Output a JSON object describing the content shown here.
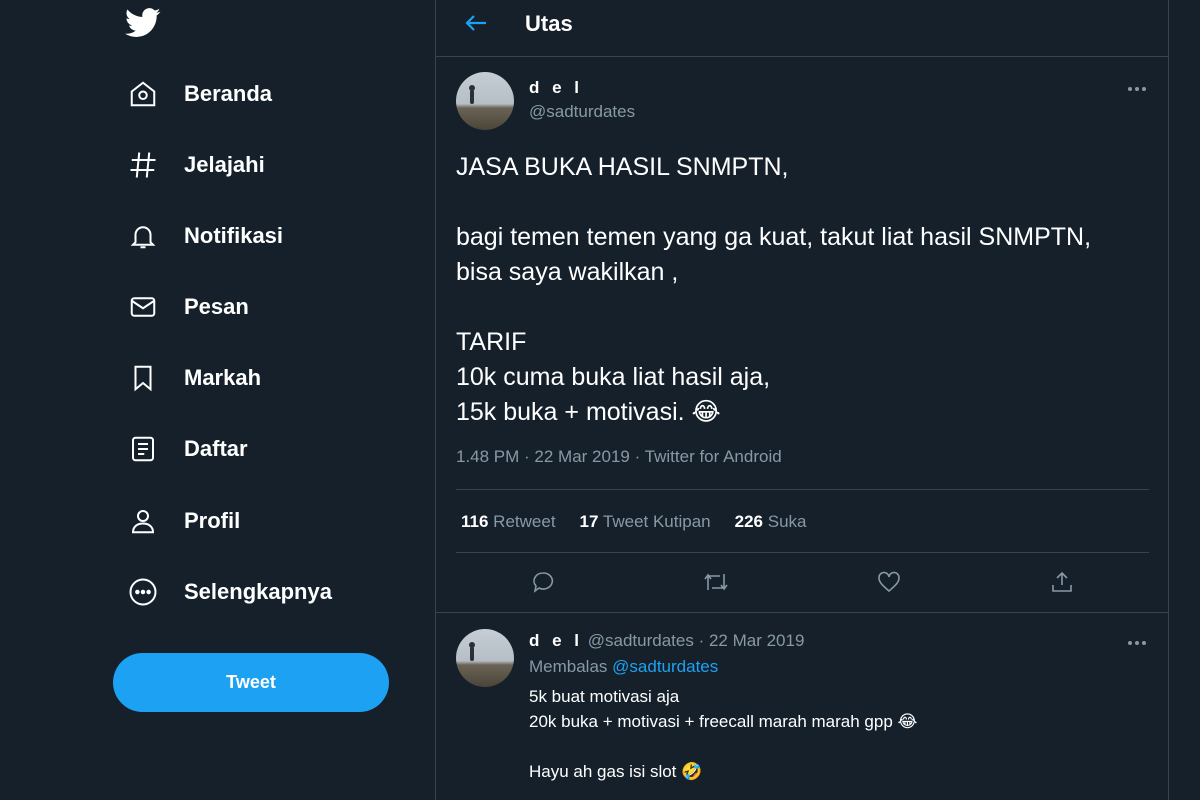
{
  "sidebar": {
    "logo_icon": "twitter-bird-icon",
    "items": [
      {
        "label": "Beranda",
        "icon": "home-icon"
      },
      {
        "label": "Jelajahi",
        "icon": "hashtag-icon"
      },
      {
        "label": "Notifikasi",
        "icon": "bell-icon"
      },
      {
        "label": "Pesan",
        "icon": "mail-icon"
      },
      {
        "label": "Markah",
        "icon": "bookmark-icon"
      },
      {
        "label": "Daftar",
        "icon": "list-icon"
      },
      {
        "label": "Profil",
        "icon": "profile-icon"
      },
      {
        "label": "Selengkapnya",
        "icon": "more-circle-icon"
      }
    ],
    "tweet_button": "Tweet"
  },
  "header": {
    "title": "Utas",
    "back_icon": "arrow-left-icon"
  },
  "main_tweet": {
    "name": "d e l",
    "handle": "@sadturdates",
    "text": "JASA BUKA HASIL SNMPTN,\n\nbagi temen temen yang ga kuat, takut liat hasil SNMPTN,\nbisa saya wakilkan ,\n\nTARIF\n10k cuma buka liat hasil aja,\n15k buka + motivasi. 😂",
    "meta": "1.48 PM · 22 Mar 2019 · Twitter for Android",
    "stats": {
      "retweets": "116",
      "retweets_label": "Retweet",
      "quotes": "17",
      "quotes_label": "Tweet Kutipan",
      "likes": "226",
      "likes_label": "Suka"
    }
  },
  "reply_tweet": {
    "name": "d e l",
    "handle": "@sadturdates",
    "date": "· 22 Mar 2019",
    "replying_label": "Membalas",
    "replying_to": "@sadturdates",
    "text": "5k buat motivasi aja\n20k buka + motivasi + freecall marah marah gpp 😂\n\nHayu ah gas isi slot 🤣"
  },
  "colors": {
    "background": "#15202b",
    "border": "#38444d",
    "accent": "#1da1f2",
    "secondary_text": "#8899a6"
  }
}
